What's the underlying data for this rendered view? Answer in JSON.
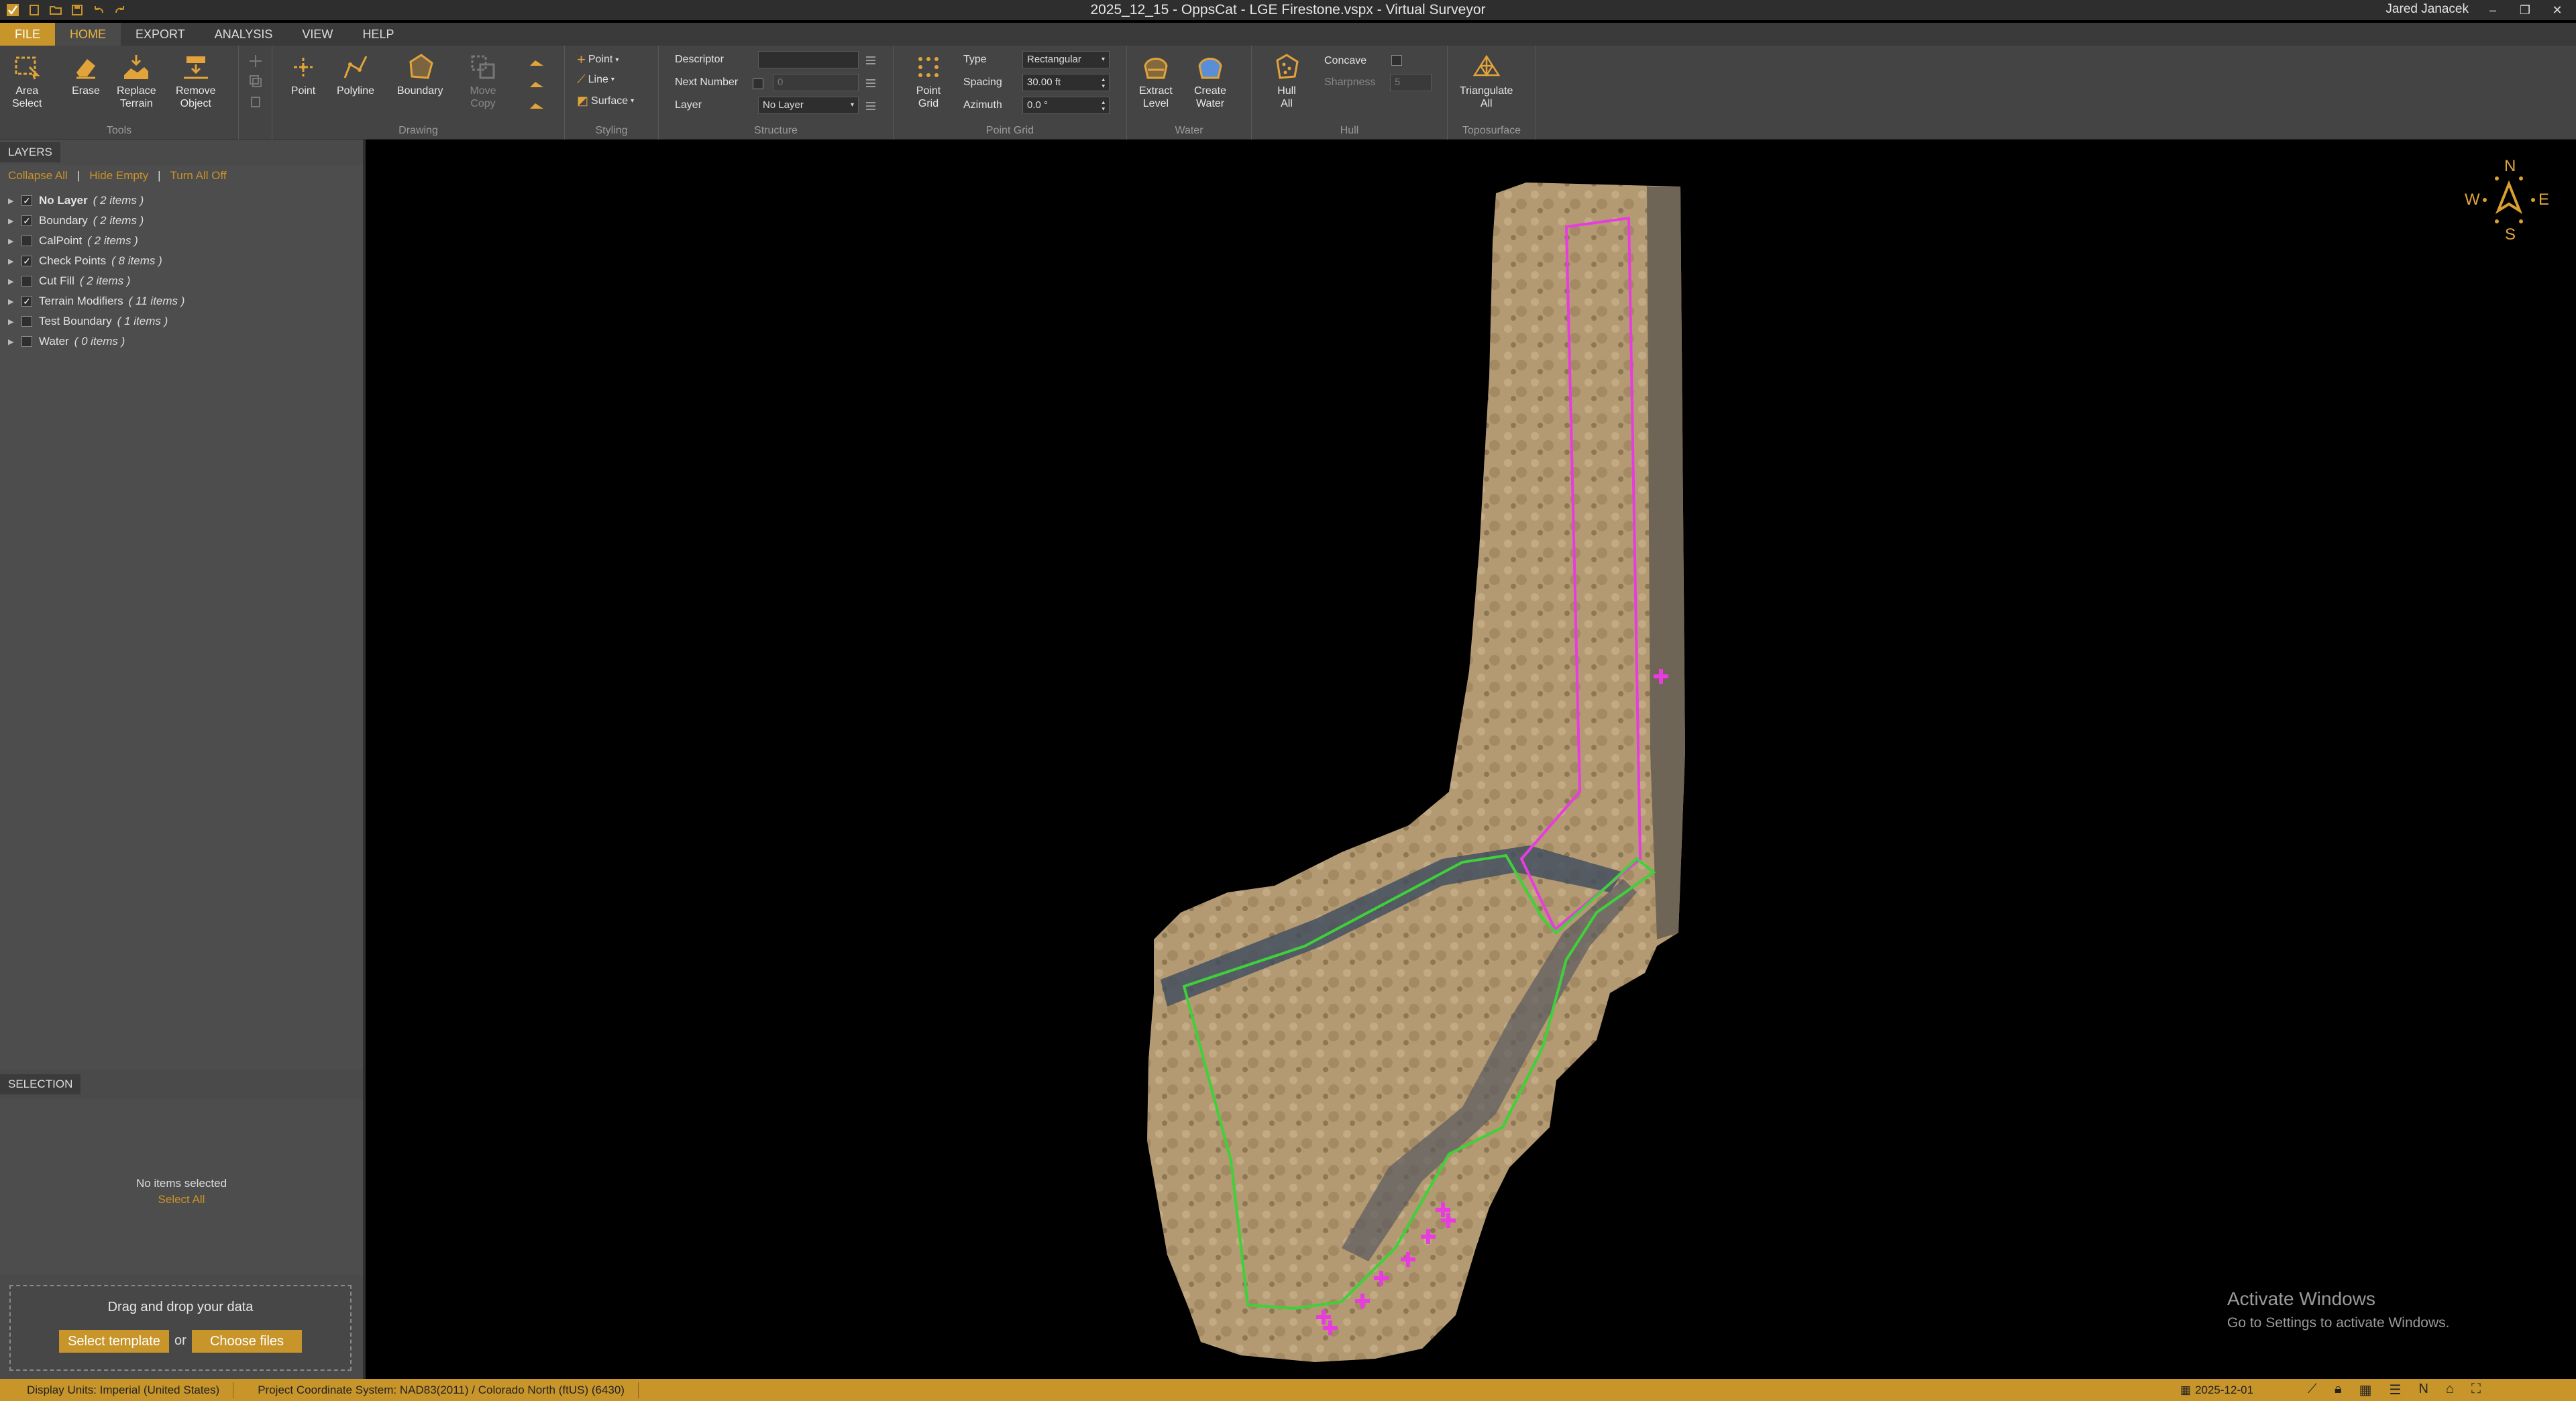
{
  "window": {
    "title": "2025_12_15 - OppsCat - LGE Firestone.vspx  -  Virtual Surveyor",
    "user": "Jared Janacek"
  },
  "tabs": [
    "FILE",
    "HOME",
    "EXPORT",
    "ANALYSIS",
    "VIEW",
    "HELP"
  ],
  "ribbon": {
    "tools": {
      "label": "Tools",
      "area_select": "Area\nSelect",
      "erase": "Erase",
      "replace_terrain": "Replace\nTerrain",
      "remove_object": "Remove\nObject"
    },
    "drawing": {
      "label": "Drawing",
      "point": "Point",
      "polyline": "Polyline",
      "boundary": "Boundary",
      "move_copy": "Move\nCopy"
    },
    "styling": {
      "label": "Styling",
      "point": "Point",
      "line": "Line",
      "surface": "Surface"
    },
    "structure": {
      "label": "Structure",
      "descriptor": "Descriptor",
      "descriptor_value": "",
      "next_number": "Next Number",
      "next_number_value": "0",
      "layer": "Layer",
      "layer_value": "No Layer"
    },
    "point_grid": {
      "label": "Point Grid",
      "button": "Point\nGrid",
      "type": "Type",
      "type_value": "Rectangular",
      "spacing": "Spacing",
      "spacing_value": "30.00 ft",
      "azimuth": "Azimuth",
      "azimuth_value": "0.0 °"
    },
    "water": {
      "label": "Water",
      "extract_level": "Extract\nLevel",
      "create_water": "Create\nWater"
    },
    "hull": {
      "label": "Hull",
      "hull_all": "Hull\nAll",
      "concave": "Concave",
      "sharpness": "Sharpness",
      "sharpness_value": "5"
    },
    "toposurface": {
      "label": "Toposurface",
      "triangulate_all": "Triangulate\nAll"
    }
  },
  "layers_panel": {
    "tab": "LAYERS",
    "collapse_all": "Collapse All",
    "hide_empty": "Hide Empty",
    "turn_all_off": "Turn All Off",
    "items": [
      {
        "name": "No Layer",
        "count": "( 2 items )",
        "checked": true,
        "bold": true
      },
      {
        "name": "Boundary",
        "count": "( 2 items )",
        "checked": true
      },
      {
        "name": "CalPoint",
        "count": "( 2 items )",
        "checked": false
      },
      {
        "name": "Check Points",
        "count": "( 8 items )",
        "checked": true
      },
      {
        "name": "Cut Fill",
        "count": "( 2 items )",
        "checked": false
      },
      {
        "name": "Terrain Modifiers",
        "count": "( 11 items )",
        "checked": true
      },
      {
        "name": "Test Boundary",
        "count": "( 1 items )",
        "checked": false
      },
      {
        "name": "Water",
        "count": "( 0 items )",
        "checked": false
      }
    ]
  },
  "selection_panel": {
    "tab": "SELECTION",
    "empty": "No items selected",
    "select_all": "Select All"
  },
  "dropzone": {
    "title": "Drag and drop your data",
    "select_template": "Select template",
    "or": "or",
    "choose_files": "Choose files"
  },
  "compass": {
    "n": "N",
    "e": "E",
    "s": "S",
    "w": "W"
  },
  "watermark": {
    "line1": "Activate Windows",
    "line2": "Go to Settings to activate Windows."
  },
  "status": {
    "display_units": "Display Units:  Imperial (United States)",
    "crs": "Project Coordinate System:  NAD83(2011) / Colorado North (ftUS) (6430)",
    "date": "2025-12-01"
  },
  "colors": {
    "accent": "#c8952b",
    "boundary_magenta": "#e83ce0",
    "boundary_green": "#3fd13a"
  }
}
